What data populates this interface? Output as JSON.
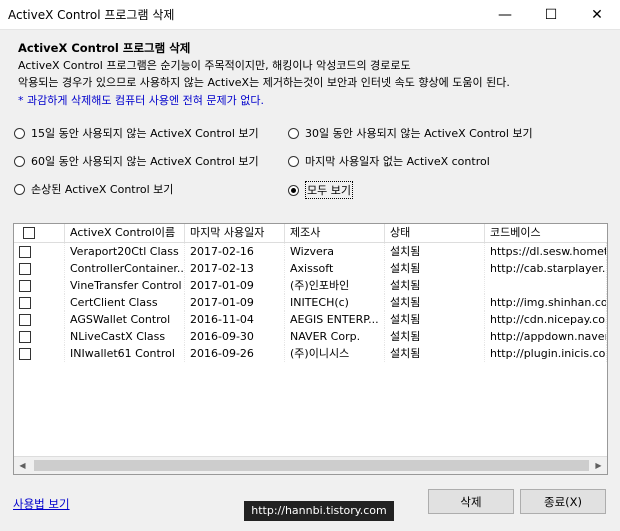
{
  "window": {
    "title": "ActiveX Control 프로그램 삭제"
  },
  "header": {
    "heading": "ActiveX Control 프로그램 삭제",
    "desc1": "ActiveX Control 프로그램은 순기능이 주목적이지만, 해킹이나 악성코드의 경로로도",
    "desc2": "악용되는 경우가 있으므로 사용하지 않는 ActiveX는 제거하는것이 보안과 인터넷 속도 향상에 도움이 된다.",
    "note": "* 과감하게 삭제해도 컴퓨터 사용엔 전혀 문제가 없다."
  },
  "filters": {
    "f15": "15일 동안 사용되지 않는 ActiveX Control 보기",
    "f30": "30일 동안 사용되지 않는 ActiveX Control 보기",
    "f60": "60일 동안 사용되지 않는 ActiveX Control 보기",
    "fnolast": "마지막 사용일자 없는 ActiveX control",
    "fbroken": "손상된 ActiveX Control 보기",
    "fall": "모두 보기",
    "selected": "fall"
  },
  "table": {
    "headers": {
      "name": "ActiveX Control이름",
      "last": "마지막 사용일자",
      "vendor": "제조사",
      "status": "상태",
      "codebase": "코드베이스"
    },
    "rows": [
      {
        "name": "Veraport20Ctl Class",
        "last": "2017-02-16",
        "vendor": "Wizvera",
        "status": "설치됨",
        "codebase": "https://dl.sesw.hometax"
      },
      {
        "name": "ControllerContainer...",
        "last": "2017-02-13",
        "vendor": "Axissoft",
        "status": "설치됨",
        "codebase": "http://cab.starplayer.sk"
      },
      {
        "name": "VineTransfer Control",
        "last": "2017-01-09",
        "vendor": "(주)인포바인",
        "status": "설치됨",
        "codebase": ""
      },
      {
        "name": "CertClient Class",
        "last": "2017-01-09",
        "vendor": "INITECH(c)",
        "status": "설치됨",
        "codebase": "http://img.shinhan.com/s"
      },
      {
        "name": "AGSWallet Control",
        "last": "2016-11-04",
        "vendor": "AEGIS ENTERP...",
        "status": "설치됨",
        "codebase": "http://cdn.nicepay.co.kr"
      },
      {
        "name": "NLiveCastX Class",
        "last": "2016-09-30",
        "vendor": "NAVER Corp.",
        "status": "설치됨",
        "codebase": "http://appdown.naver.c"
      },
      {
        "name": "INIwallet61 Control",
        "last": "2016-09-26",
        "vendor": "(주)이니시스",
        "status": "설치됨",
        "codebase": "http://plugin.inicis.com/w"
      }
    ]
  },
  "footer": {
    "usage_link": "사용법 보기",
    "watermark": "http://hannbi.tistory.com",
    "delete_label": "삭제",
    "close_label": "종료(X)"
  }
}
